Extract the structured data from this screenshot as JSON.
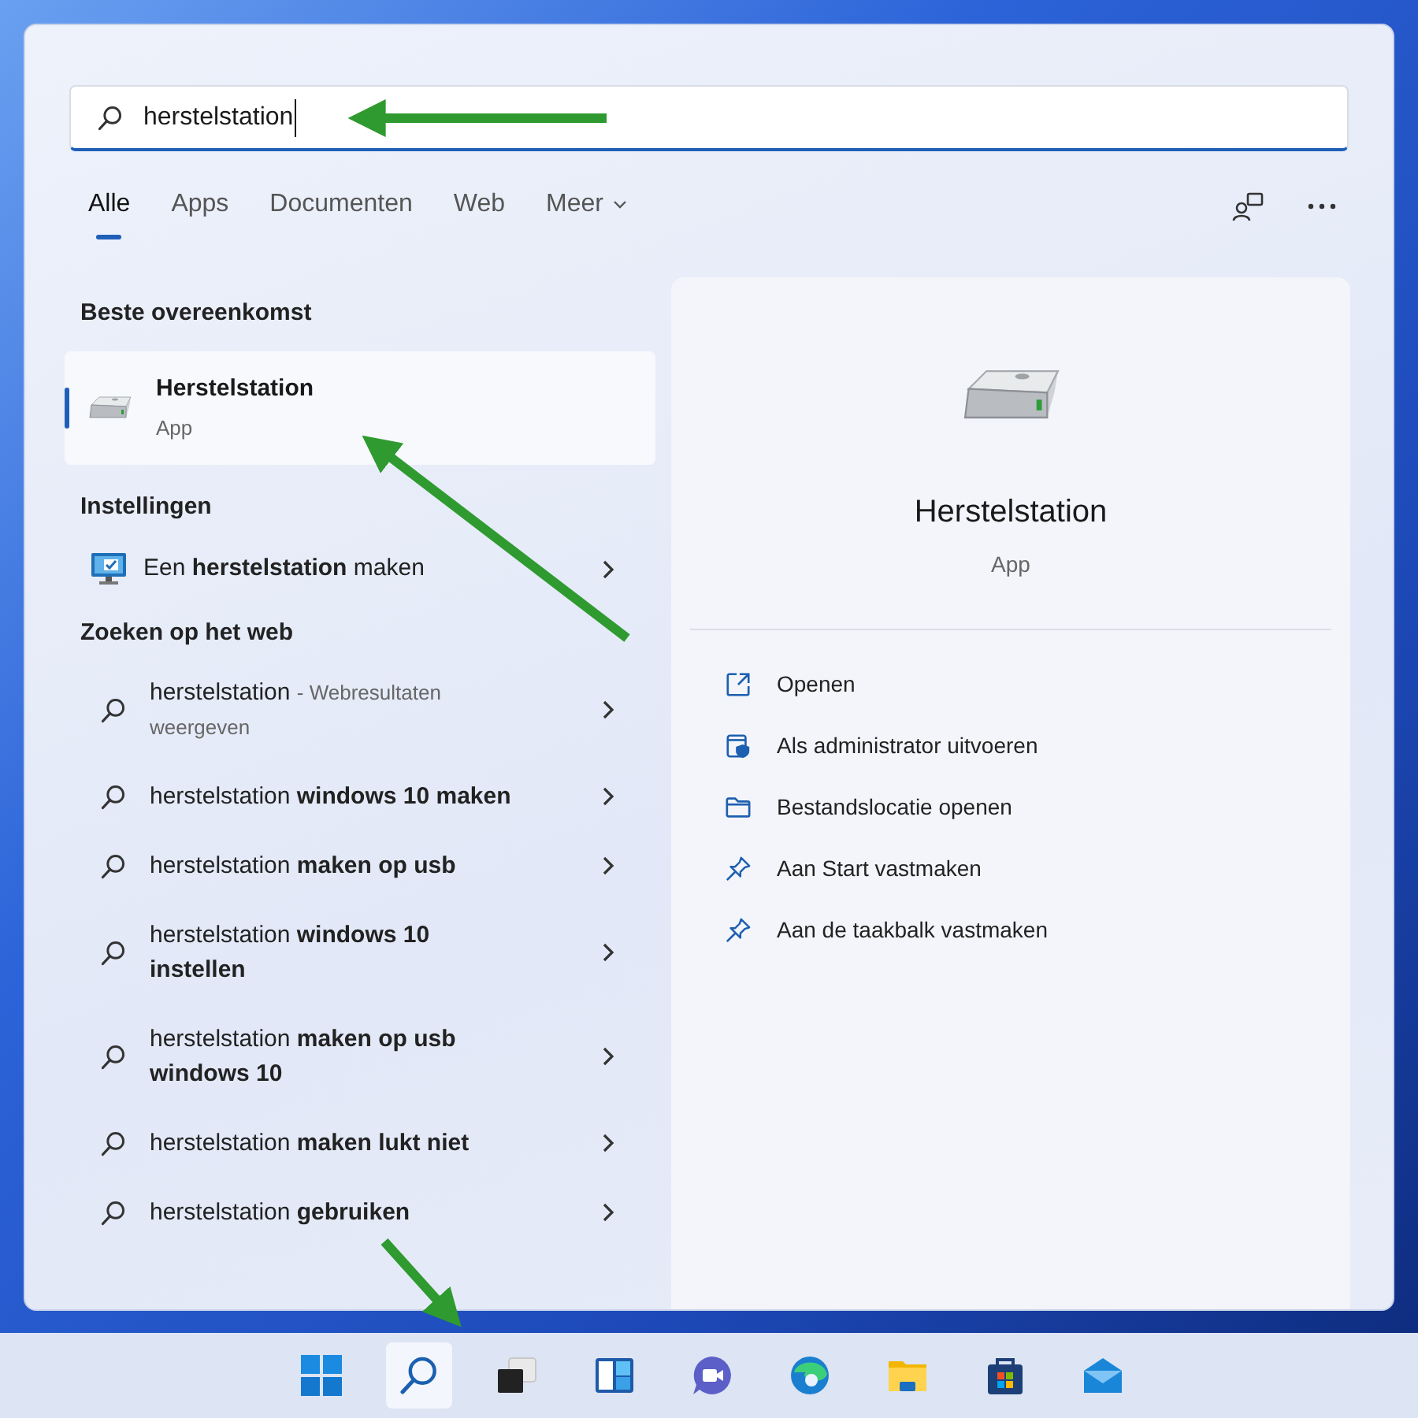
{
  "search": {
    "value": "herstelstation"
  },
  "tabs": [
    {
      "label": "Alle",
      "selected": true,
      "has_menu": false
    },
    {
      "label": "Apps",
      "selected": false,
      "has_menu": false
    },
    {
      "label": "Documenten",
      "selected": false,
      "has_menu": false
    },
    {
      "label": "Web",
      "selected": false,
      "has_menu": false
    },
    {
      "label": "Meer",
      "selected": false,
      "has_menu": true
    }
  ],
  "best_match": {
    "heading": "Beste overeenkomst",
    "item": {
      "title": "Herstelstation",
      "subtitle": "App",
      "selected": true
    }
  },
  "settings": {
    "heading": "Instellingen",
    "items": [
      {
        "text": "Een **herstelstation** maken"
      }
    ]
  },
  "web": {
    "heading": "Zoeken op het web",
    "items": [
      {
        "kind": "web_results",
        "text": "herstelstation",
        "note": "- Webresultaten weergeven"
      },
      {
        "kind": "suggestion",
        "text": "herstelstation **windows 10 maken**"
      },
      {
        "kind": "suggestion",
        "text": "herstelstation **maken op usb**"
      },
      {
        "kind": "suggestion",
        "text": "herstelstation **windows 10 instellen**"
      },
      {
        "kind": "suggestion",
        "text": "herstelstation **maken op usb windows 10**"
      },
      {
        "kind": "suggestion",
        "text": "herstelstation **maken lukt niet**"
      },
      {
        "kind": "suggestion",
        "text": "herstelstation **gebruiken**"
      }
    ]
  },
  "preview": {
    "title": "Herstelstation",
    "subtitle": "App",
    "actions": [
      {
        "kind": "open",
        "label": "Openen"
      },
      {
        "kind": "admin",
        "label": "Als administrator uitvoeren"
      },
      {
        "kind": "folder",
        "label": "Bestandslocatie openen"
      },
      {
        "kind": "pin",
        "label": "Aan Start vastmaken"
      },
      {
        "kind": "pin",
        "label": "Aan de taakbalk vastmaken"
      }
    ]
  },
  "taskbar": [
    {
      "kind": "start",
      "selected": false
    },
    {
      "kind": "search",
      "selected": true
    },
    {
      "kind": "task_view",
      "selected": false
    },
    {
      "kind": "widgets",
      "selected": false
    },
    {
      "kind": "chat",
      "selected": false
    },
    {
      "kind": "browser",
      "selected": false
    },
    {
      "kind": "explorer",
      "selected": false
    },
    {
      "kind": "store",
      "selected": false
    },
    {
      "kind": "mail",
      "selected": false
    }
  ]
}
